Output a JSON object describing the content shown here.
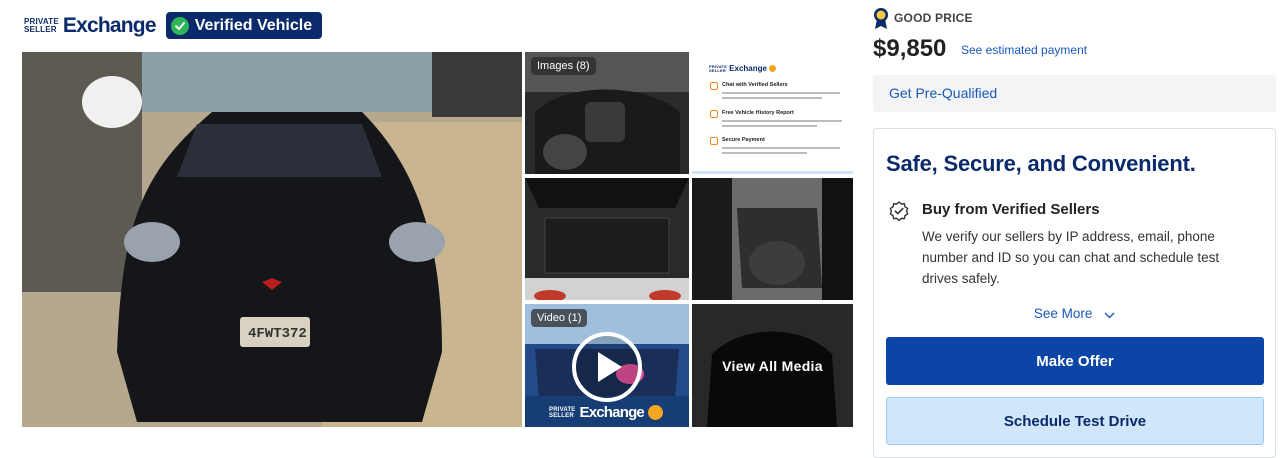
{
  "brand": {
    "logo_small_line1": "PRIVATE",
    "logo_small_line2": "SELLER",
    "logo_big": "Exchange",
    "verified_label": "Verified Vehicle"
  },
  "gallery": {
    "images_label": "Images (8)",
    "video_label": "Video (1)",
    "view_all_label": "View All Media",
    "license_plate": "4FWT372",
    "info_card": {
      "logo_small_line1": "PRIVATE",
      "logo_small_line2": "SELLER",
      "logo_big": "Exchange",
      "items": [
        "Chat with Verified Sellers",
        "Free Vehicle History Report",
        "Secure Payment"
      ]
    },
    "video_logo_small_line1": "PRIVATE",
    "video_logo_small_line2": "SELLER",
    "video_logo_big": "Exchange"
  },
  "pricing": {
    "badge": "GOOD PRICE",
    "price": "$9,850",
    "estimate_link": "See estimated payment",
    "prequalify": "Get Pre-Qualified"
  },
  "benefits_card": {
    "title": "Safe, Secure, and Convenient.",
    "feature_title": "Buy from Verified Sellers",
    "feature_description": "We verify our sellers by IP address, email, phone number and ID so you can chat and schedule test drives safely.",
    "see_more": "See More",
    "make_offer": "Make Offer",
    "schedule_test_drive": "Schedule Test Drive"
  },
  "colors": {
    "brand_navy": "#0b2a6b",
    "primary_blue": "#0b45a5",
    "link_blue": "#1a58b8",
    "verified_green": "#2fb457",
    "secondary_button_bg": "#cfe6fb"
  }
}
